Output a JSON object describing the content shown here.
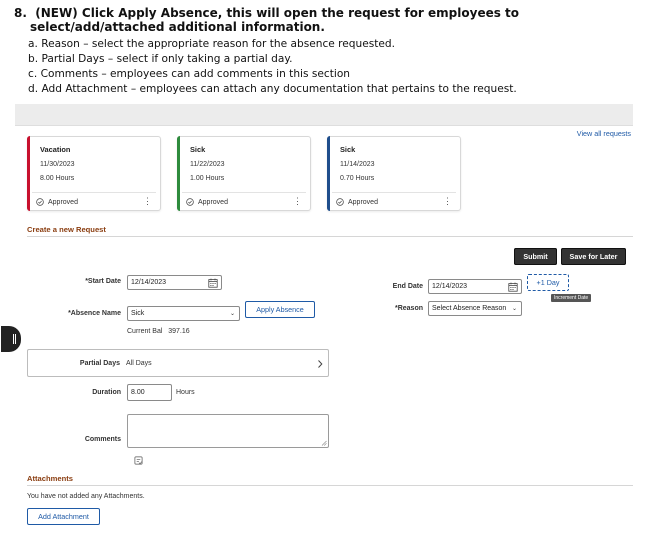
{
  "instructions": {
    "number": "8.",
    "heading": "(NEW) Click Apply Absence, this will open the request for employees to select/add/attached additional information.",
    "items": [
      {
        "marker": "a.",
        "text": "Reason – select the appropriate reason for the absence requested."
      },
      {
        "marker": "b.",
        "text": "Partial Days – select if only taking a partial day."
      },
      {
        "marker": "c.",
        "text": "Comments – employees can add comments in this section"
      },
      {
        "marker": "d.",
        "text": "Add Attachment – employees can attach any documentation that pertains to the request."
      }
    ]
  },
  "view_all": "View all requests",
  "cards": [
    {
      "type": "Vacation",
      "date": "11/30/2023",
      "hours": "8.00 Hours",
      "status": "Approved",
      "color": "#c8102e"
    },
    {
      "type": "Sick",
      "date": "11/22/2023",
      "hours": "1.00 Hours",
      "status": "Approved",
      "color": "#2e8b3d"
    },
    {
      "type": "Sick",
      "date": "11/14/2023",
      "hours": "0.70 Hours",
      "status": "Approved",
      "color": "#1f4e8c"
    }
  ],
  "new_request": {
    "title": "Create a new Request",
    "submit": "Submit",
    "save_later": "Save for Later",
    "start_date_label": "*Start Date",
    "start_date": "12/14/2023",
    "end_date_label": "End Date",
    "end_date": "12/14/2023",
    "plus_day": "+1 Day",
    "tooltip": "Increment Date",
    "absence_name_label": "*Absence Name",
    "absence_name": "Sick",
    "apply_absence": "Apply Absence",
    "reason_label": "*Reason",
    "reason_value": "Select Absence Reason",
    "current_bal_label": "Current Bal",
    "current_bal": "397.16",
    "partial_days_label": "Partial Days",
    "partial_days_value": "All Days",
    "duration_label": "Duration",
    "duration": "8.00",
    "duration_unit": "Hours",
    "comments_label": "Comments"
  },
  "attachments": {
    "title": "Attachments",
    "empty": "You have not added any Attachments.",
    "add_button": "Add Attachment"
  },
  "colors": {
    "accent": "#1f5aa6",
    "section": "#8a3d10",
    "dark_button": "#333333"
  }
}
